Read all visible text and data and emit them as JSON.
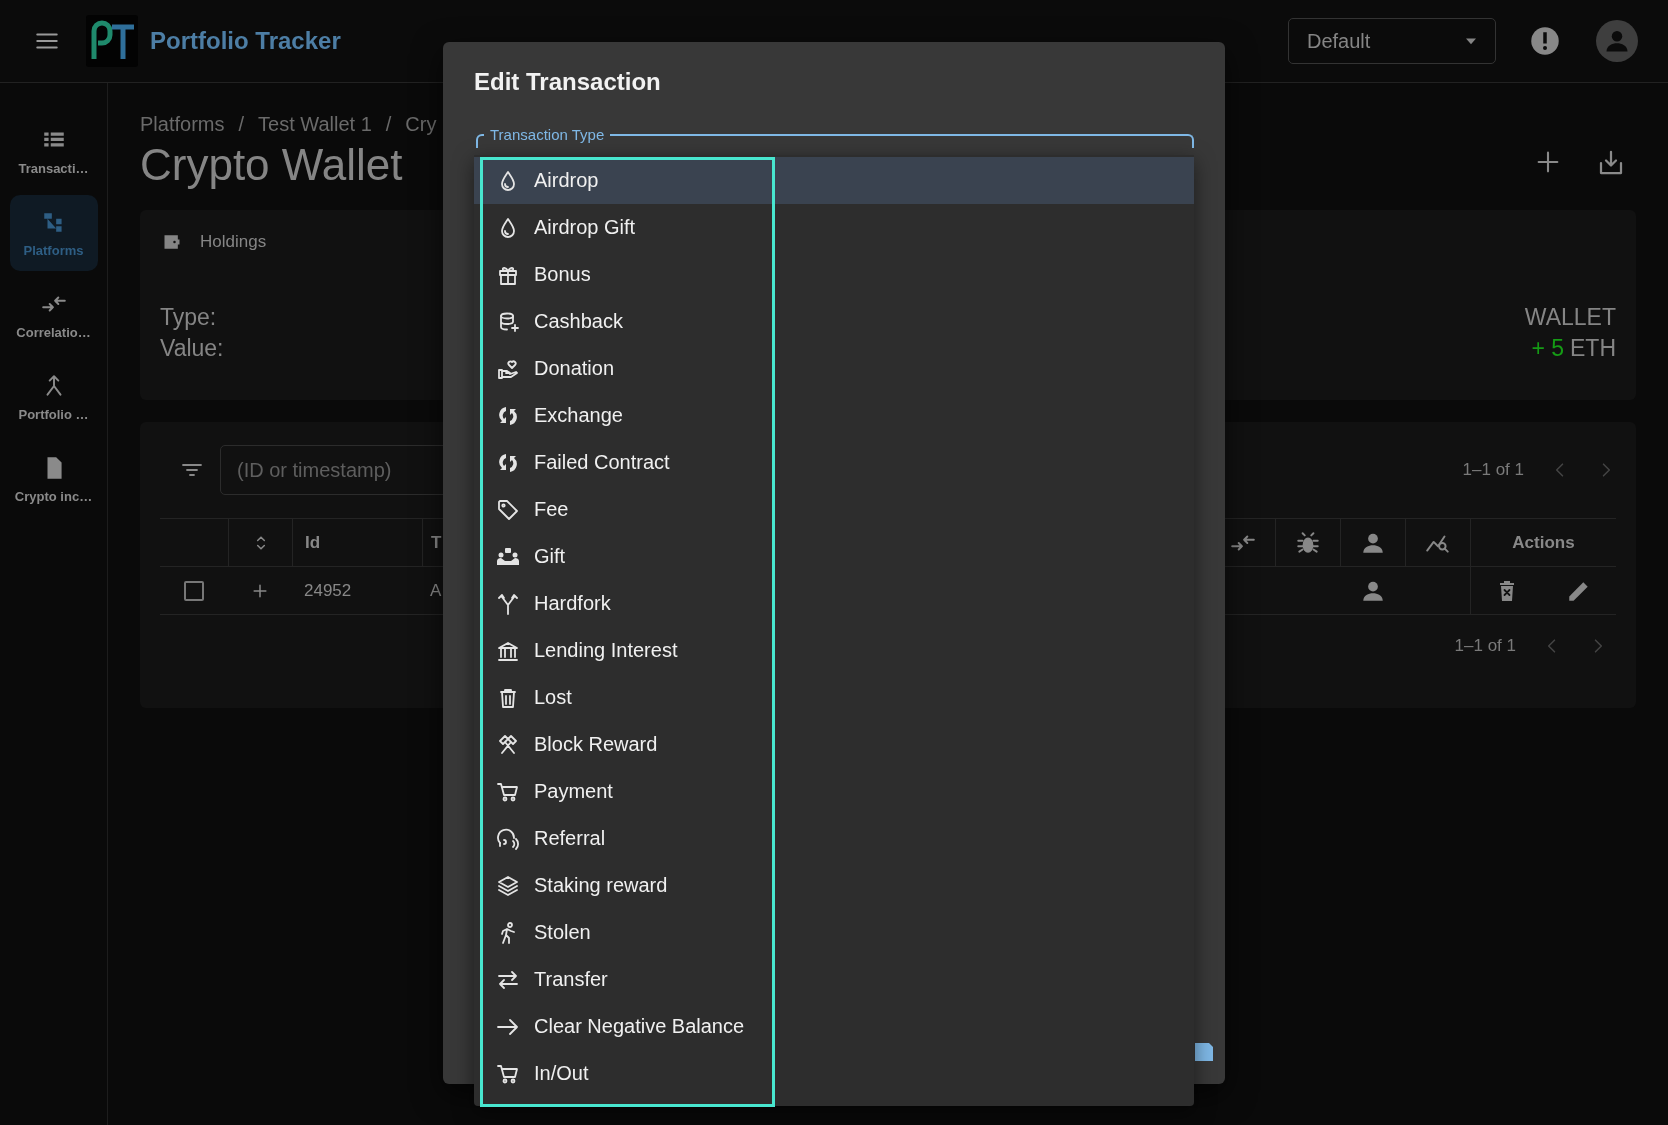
{
  "app_bar": {
    "title": "Portfolio Tracker",
    "profile_select": {
      "value": "Default"
    }
  },
  "sidebar": {
    "items": [
      {
        "label": "Transacti…",
        "selected": false
      },
      {
        "label": "Platforms",
        "selected": true
      },
      {
        "label": "Correlatio…",
        "selected": false
      },
      {
        "label": "Portfolio …",
        "selected": false
      },
      {
        "label": "Crypto inc…",
        "selected": false
      }
    ]
  },
  "breadcrumbs": {
    "separator": "/",
    "items": [
      "Platforms",
      "Test Wallet 1",
      "Cry"
    ]
  },
  "page_title": "Crypto Wallet",
  "holdings": {
    "title": "Holdings",
    "fields": [
      {
        "label": "Type:",
        "value": "WALLET"
      },
      {
        "label": "Value:",
        "delta": "+ 5",
        "value": "ETH"
      }
    ]
  },
  "transactions_table": {
    "filter_placeholder": "(ID or timestamp)",
    "pagination": "1–1 of 1",
    "columns": {
      "id": "Id",
      "column_4": "T",
      "actions": "Actions"
    },
    "rows": [
      {
        "selected": false,
        "id": "24952",
        "column_4": "A"
      }
    ],
    "footer_pagination": "1–1 of 1"
  },
  "dialog": {
    "title": "Edit Transaction",
    "field_label": "Transaction Type",
    "options": [
      {
        "label": "Airdrop",
        "selected": true
      },
      {
        "label": "Airdrop Gift",
        "selected": false
      },
      {
        "label": "Bonus",
        "selected": false
      },
      {
        "label": "Cashback",
        "selected": false
      },
      {
        "label": "Donation",
        "selected": false
      },
      {
        "label": "Exchange",
        "selected": false
      },
      {
        "label": "Failed Contract",
        "selected": false
      },
      {
        "label": "Fee",
        "selected": false
      },
      {
        "label": "Gift",
        "selected": false
      },
      {
        "label": "Hardfork",
        "selected": false
      },
      {
        "label": "Lending Interest",
        "selected": false
      },
      {
        "label": "Lost",
        "selected": false
      },
      {
        "label": "Block Reward",
        "selected": false
      },
      {
        "label": "Payment",
        "selected": false
      },
      {
        "label": "Referral",
        "selected": false
      },
      {
        "label": "Staking reward",
        "selected": false
      },
      {
        "label": "Stolen",
        "selected": false
      },
      {
        "label": "Transfer",
        "selected": false
      },
      {
        "label": "Clear Negative Balance",
        "selected": false
      },
      {
        "label": "In/Out",
        "selected": false
      }
    ]
  }
}
